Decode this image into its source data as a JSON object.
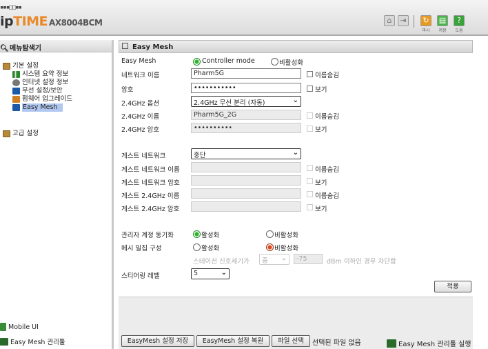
{
  "header": {
    "logo_dots": "▪▪▪□□▪▪",
    "logo_ip": "ip",
    "logo_time": "TIME",
    "model": "AX8004BCM",
    "icons": [
      "home-icon",
      "logout-icon"
    ],
    "quick": [
      {
        "label": "마시",
        "color": "#e89a20"
      },
      {
        "label": "저장",
        "color": "#4ab44a"
      },
      {
        "label": "도움",
        "color": "#3aa23a"
      }
    ]
  },
  "left": {
    "title": "메뉴탐색기",
    "tree": {
      "basic": "기본 설정",
      "items": [
        "시스템 요약 정보",
        "인터넷 설정 정보",
        "무선 설정/보안",
        "펌웨어 업그레이드",
        "Easy Mesh"
      ],
      "advanced": "고급 설정"
    },
    "mobile_ui": "Mobile UI",
    "easymesh_mgr": "Easy Mesh 관리툴"
  },
  "panel": {
    "title": "Easy Mesh",
    "easymesh_label": "Easy Mesh",
    "controller_mode": "Controller mode",
    "disable": "비활성화",
    "net_name_label": "네트워크 이름",
    "net_name_value": "Pharm5G",
    "hide_name": "이름숨김",
    "pw_label": "암호",
    "pw_value": "•••••••••••",
    "show": "보기",
    "opt24_label": "2.4GHz 옵션",
    "opt24_value": "2.4GHz 무선 분리 (자동)",
    "name24_label": "2.4GHz 이름",
    "name24_value": "Pharm5G_2G",
    "pw24_label": "2.4GHz 암호",
    "pw24_value": "••••••••••",
    "guest_label": "게스트 네트워크",
    "guest_value": "중단",
    "guest_name_label": "게스트 네트워크 이름",
    "guest_pw_label": "게스트 네트워크 암호",
    "guest_name24_label": "게스트 2.4GHz 이름",
    "guest_pw24_label": "게스트 2.4GHz 암호",
    "admin_sync_label": "관리자 계정 동기화",
    "enable": "활성화",
    "mesh_dense_label": "메시 밀집 구성",
    "station_signal": "스테이션 신호세기가",
    "signal_level": "중",
    "signal_dbm": "-75",
    "signal_suffix": "dBm 이하인 경우 차단함",
    "steering_label": "스티어링 레벨",
    "steering_value": "5",
    "apply": "적용"
  },
  "footer": {
    "save_btn": "EasyMesh 설정 저장",
    "restore_btn": "EasyMesh 설정 복원",
    "file_btn": "파일 선택",
    "no_file": "선택된 파일 없음",
    "run_mgr": "Easy Mesh 관리툴 실행"
  }
}
